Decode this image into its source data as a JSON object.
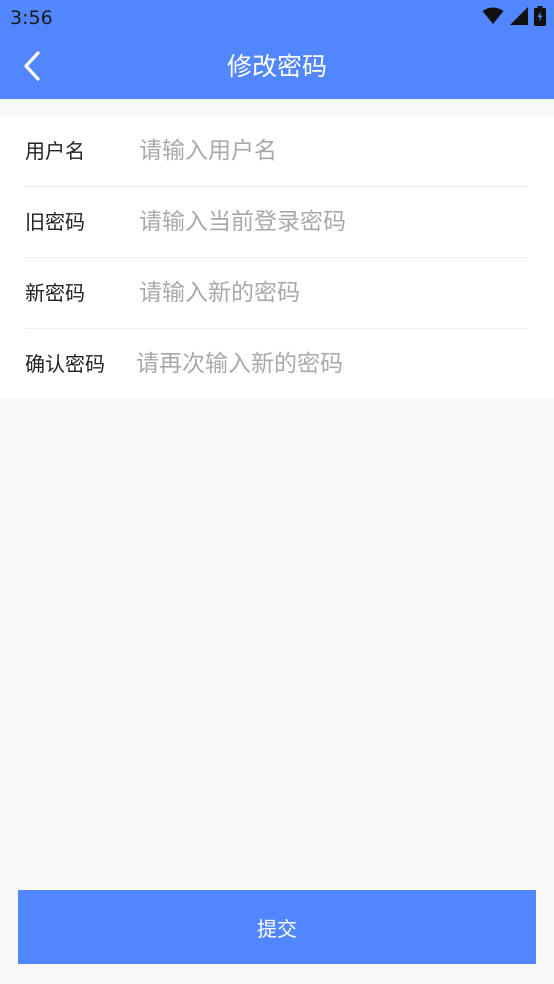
{
  "status_bar": {
    "time": "3:56",
    "icons": [
      "wifi-icon",
      "cellular-signal-icon",
      "battery-charging-icon"
    ]
  },
  "header": {
    "title": "修改密码",
    "back_icon": "chevron-left-icon"
  },
  "form": {
    "username": {
      "label": "用户名",
      "value": "",
      "placeholder": "请输入用户名"
    },
    "old_password": {
      "label": "旧密码",
      "value": "",
      "placeholder": "请输入当前登录密码"
    },
    "new_password": {
      "label": "新密码",
      "value": "",
      "placeholder": "请输入新的密码"
    },
    "confirm_password": {
      "label": "确认密码",
      "value": "",
      "placeholder": "请再次输入新的密码"
    }
  },
  "submit": {
    "label": "提交"
  },
  "colors": {
    "primary": "#5286ff",
    "background": "#f8f8f8",
    "surface": "#ffffff",
    "placeholder": "#a9a9a9",
    "label": "#222222",
    "divider": "#efefef"
  }
}
